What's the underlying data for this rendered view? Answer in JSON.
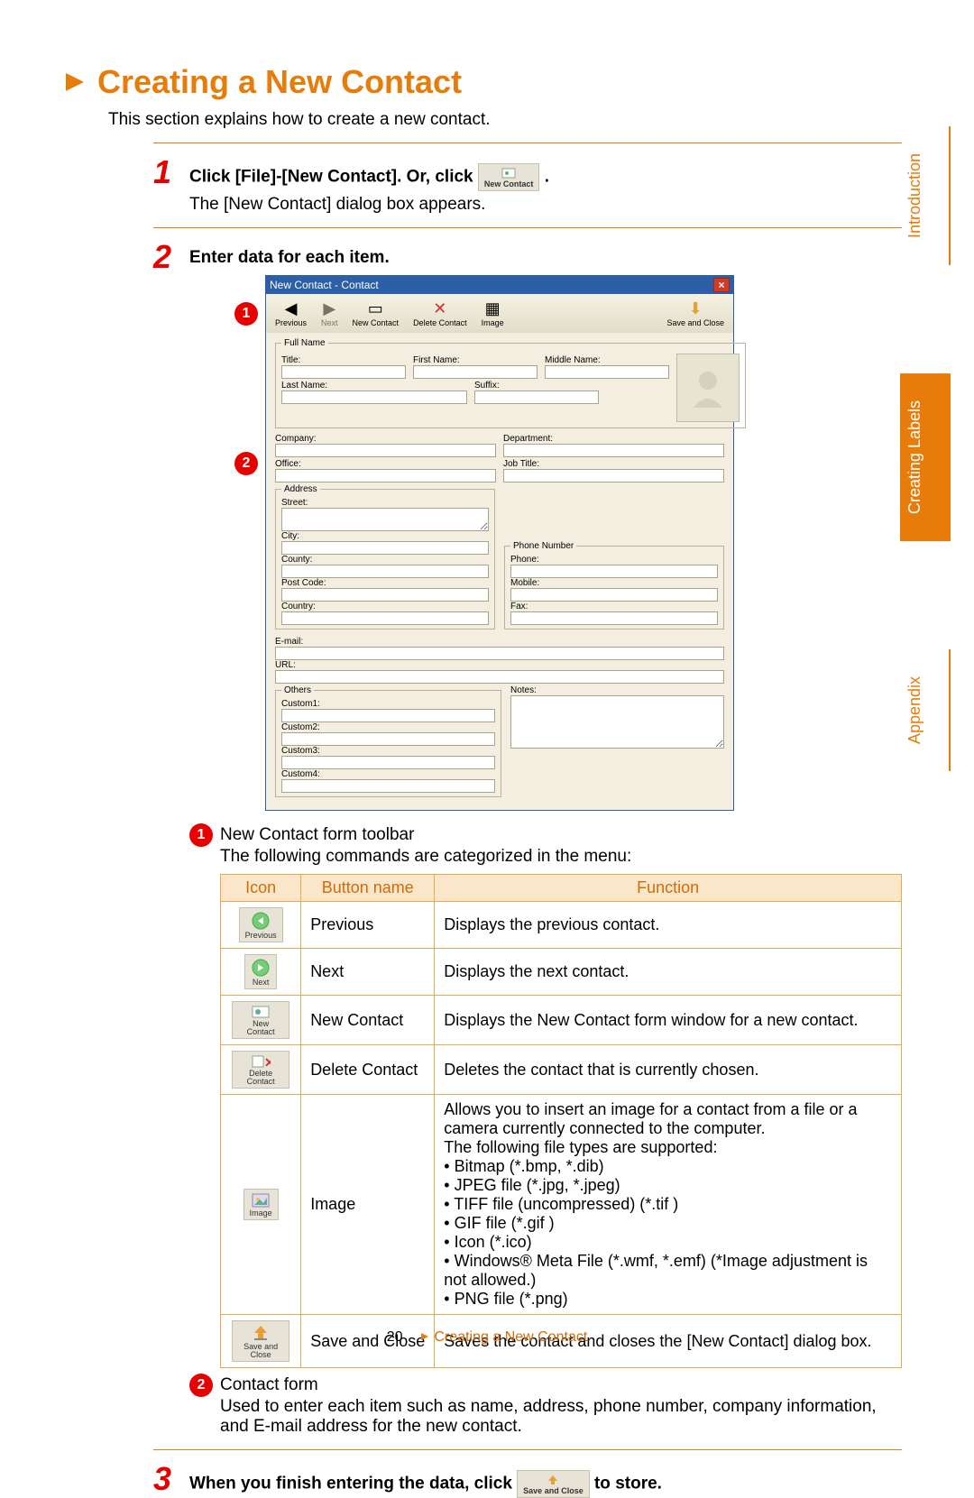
{
  "heading": "Creating a New Contact",
  "intro": "This section explains how to create a new contact.",
  "step1": {
    "title_pre": "Click [File]-[New Contact]. Or, click",
    "title_post": ".",
    "sub": "The [New Contact] dialog box appears.",
    "chip_label": "New Contact"
  },
  "step2": {
    "title": "Enter data for each item."
  },
  "step3": {
    "title_pre": "When you finish entering the data, click",
    "title_post": "to store.",
    "chip_label": "Save and Close"
  },
  "dialog": {
    "title": "New Contact - Contact",
    "toolbar": {
      "previous": "Previous",
      "next": "Next",
      "new_contact": "New Contact",
      "delete_contact": "Delete Contact",
      "image": "Image",
      "save_close": "Save and Close"
    },
    "fields": {
      "fullname_legend": "Full Name",
      "title": "Title:",
      "first": "First Name:",
      "middle": "Middle Name:",
      "last": "Last Name:",
      "suffix": "Suffix:",
      "company": "Company:",
      "department": "Department:",
      "office": "Office:",
      "jobtitle": "Job Title:",
      "address_legend": "Address",
      "street": "Street:",
      "city": "City:",
      "county": "County:",
      "postcode": "Post Code:",
      "country": "Country:",
      "phone_legend": "Phone Number",
      "phone": "Phone:",
      "mobile": "Mobile:",
      "fax": "Fax:",
      "email": "E-mail:",
      "url": "URL:",
      "others_legend": "Others",
      "custom1": "Custom1:",
      "custom2": "Custom2:",
      "custom3": "Custom3:",
      "custom4": "Custom4:",
      "notes": "Notes:"
    }
  },
  "callout1": {
    "num": "1",
    "title": "New Contact form toolbar",
    "sub": "The following commands are categorized in the menu:"
  },
  "table": {
    "headers": {
      "icon": "Icon",
      "name": "Button name",
      "func": "Function"
    },
    "rows": [
      {
        "chip": "Previous",
        "name": "Previous",
        "func": "Displays the previous contact."
      },
      {
        "chip": "Next",
        "name": "Next",
        "func": "Displays the next contact."
      },
      {
        "chip": "New Contact",
        "name": "New Contact",
        "func": "Displays the New Contact form window for a new contact."
      },
      {
        "chip": "Delete Contact",
        "name": "Delete Contact",
        "func": "Deletes the contact that is currently chosen."
      },
      {
        "chip": "Image",
        "name": "Image",
        "func": "Allows you to insert an image for a contact from a file or a camera currently connected to the computer.\nThe following file types are supported:\n• Bitmap (*.bmp, *.dib)\n• JPEG file (*.jpg, *.jpeg)\n• TIFF file (uncompressed) (*.tif )\n• GIF file (*.gif )\n• Icon (*.ico)\n• Windows® Meta File (*.wmf, *.emf) (*Image adjustment is not allowed.)\n• PNG file (*.png)"
      },
      {
        "chip": "Save and Close",
        "name": "Save and Close",
        "func": "Saves the contact and closes the [New Contact] dialog box."
      }
    ]
  },
  "callout2": {
    "num": "2",
    "title": "Contact form",
    "sub": "Used to enter each item such as name, address, phone number, company information, and E-mail address for the new contact."
  },
  "footer": {
    "page": "20",
    "title": "Creating a New Contact"
  },
  "side_tabs": {
    "intro": "Introduction",
    "creating": "Creating Labels",
    "appendix": "Appendix"
  }
}
